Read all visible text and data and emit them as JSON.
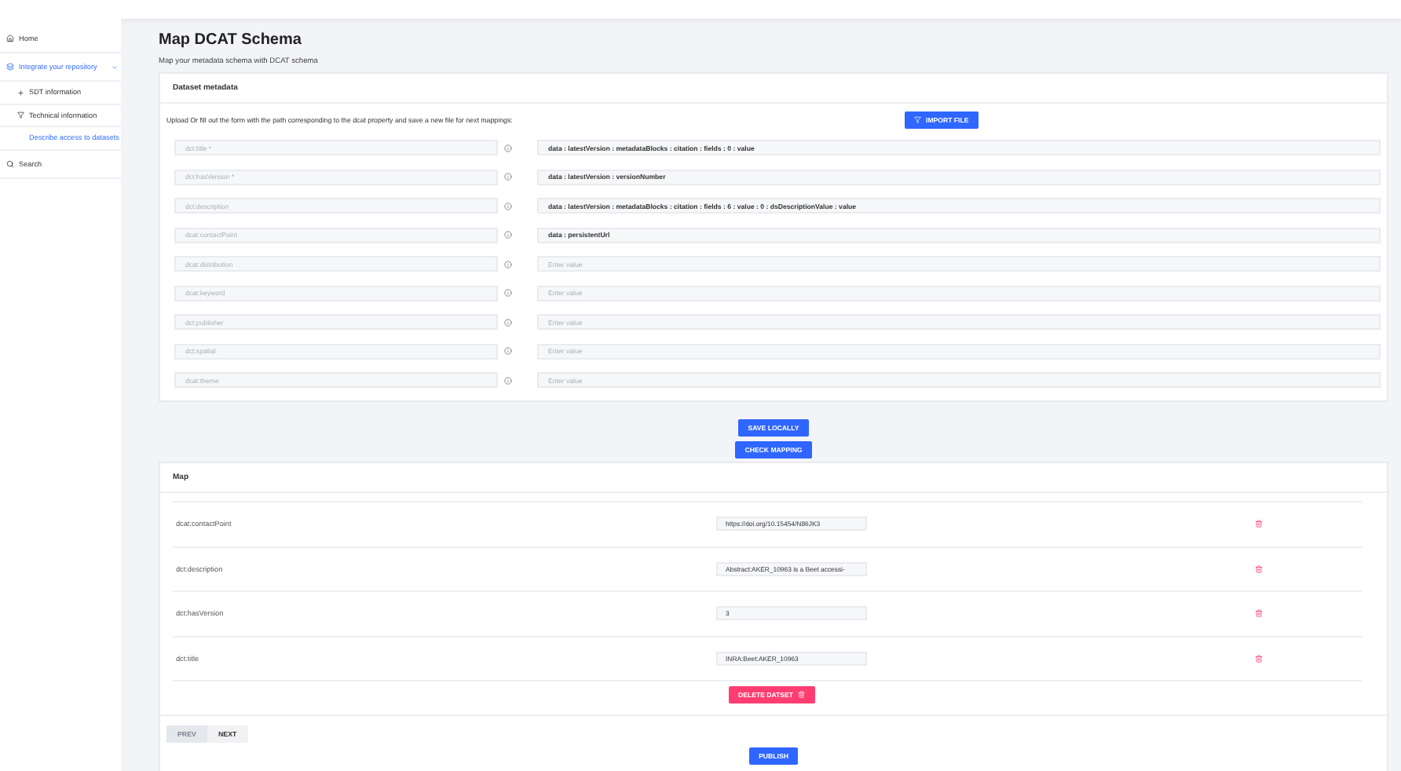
{
  "sidebar": {
    "items": [
      {
        "label": "Home",
        "selected": false
      },
      {
        "label": "Integrate your repository",
        "selected": true,
        "expanded": true,
        "children": [
          {
            "label": "SDT information",
            "selected": false
          },
          {
            "label": "Technical information",
            "selected": false
          },
          {
            "label": "Describe access to datasets",
            "selected": true
          }
        ]
      },
      {
        "label": "Search",
        "selected": false
      }
    ]
  },
  "page": {
    "title": "Map DCAT Schema",
    "subtitle": "Map your metadata schema with DCAT schema"
  },
  "dataset_metadata": {
    "title": "Dataset metadata",
    "instructions": "Upload Or fill out the form with the path corresponding to the dcat property and save a new file for next mappings:",
    "import_button": "IMPORT FILE",
    "rows": [
      {
        "property": {
          "placeholder": "dct:title *"
        },
        "mapping": {
          "value": "data : latestVersion : metadataBlocks : citation : fields : 0 : value"
        }
      },
      {
        "property": {
          "placeholder": "dct:hasVersion *"
        },
        "mapping": {
          "value": "data : latestVersion : versionNumber"
        }
      },
      {
        "property": {
          "placeholder": "dct:description"
        },
        "mapping": {
          "value": "data : latestVersion : metadataBlocks : citation : fields : 6 : value : 0 : dsDescriptionValue : value"
        }
      },
      {
        "property": {
          "placeholder": "dcat:contactPoint"
        },
        "mapping": {
          "value": "data : persistentUrl"
        }
      },
      {
        "property": {
          "placeholder": "dcat:distribution"
        },
        "mapping": {
          "placeholder": "Enter value"
        }
      },
      {
        "property": {
          "placeholder": "dcat:keyword"
        },
        "mapping": {
          "placeholder": "Enter value"
        }
      },
      {
        "property": {
          "placeholder": "dct:publisher"
        },
        "mapping": {
          "placeholder": "Enter value"
        }
      },
      {
        "property": {
          "placeholder": "dct:spatial"
        },
        "mapping": {
          "placeholder": "Enter value"
        }
      },
      {
        "property": {
          "placeholder": "dcat:theme"
        },
        "mapping": {
          "placeholder": "Enter value"
        }
      }
    ]
  },
  "actions": [
    "SAVE LOCALLY",
    "CHECK MAPPING"
  ],
  "map": {
    "title": "Map",
    "rows": [
      {
        "property": "dcat:contactPoint",
        "value": "https://doi.org/10.15454/N86JK3"
      },
      {
        "property": "dct:description",
        "value": "Abstract:AKER_10963 is a Beet accessi-"
      },
      {
        "property": "dct:hasVersion",
        "value": "3"
      },
      {
        "property": "dct:title",
        "value": "INRA:Beet:AKER_10963"
      }
    ],
    "delete_button": "DELETE DATSET",
    "pagination": [
      {
        "label": "PREV",
        "disabled": true
      },
      {
        "label": "NEXT",
        "disabled": false
      }
    ],
    "publish_button": "PUBLISH"
  }
}
